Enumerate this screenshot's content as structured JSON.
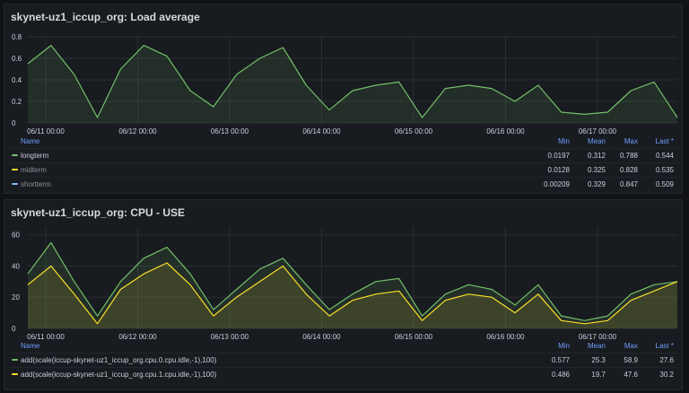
{
  "panels": [
    {
      "title": "skynet-uz1_iccup_org: Load average",
      "y_ticks": [
        "0.8",
        "0.6",
        "0.4",
        "0.2",
        "0"
      ],
      "x_ticks": [
        "06/11 00:00",
        "06/12 00:00",
        "06/13 00:00",
        "06/14 00:00",
        "06/15 00:00",
        "06/16 00:00",
        "06/17 00:00"
      ],
      "legend_headers": {
        "name": "Name",
        "min": "Min",
        "mean": "Mean",
        "max": "Max",
        "last": "Last *"
      },
      "legend": [
        {
          "name": "longterm",
          "color": "#73bf69",
          "min": "0.0197",
          "mean": "0.312",
          "max": "0.788",
          "last": "0.544"
        },
        {
          "name": "midterm",
          "color": "#fade2a",
          "min": "0.0128",
          "mean": "0.325",
          "max": "0.828",
          "last": "0.535"
        },
        {
          "name": "shortterm",
          "color": "#8ab8ff",
          "min": "0.00209",
          "mean": "0.329",
          "max": "0.847",
          "last": "0.509"
        }
      ]
    },
    {
      "title": "skynet-uz1_iccup_org: CPU - USE",
      "y_ticks": [
        "60",
        "40",
        "20",
        "0"
      ],
      "x_ticks": [
        "06/11 00:00",
        "06/12 00:00",
        "06/13 00:00",
        "06/14 00:00",
        "06/15 00:00",
        "06/16 00:00",
        "06/17 00:00"
      ],
      "legend_headers": {
        "name": "Name",
        "min": "Min",
        "mean": "Mean",
        "max": "Max",
        "last": "Last *"
      },
      "legend": [
        {
          "name": "add(scale(iccup-skynet-uz1_iccup_org.cpu.0.cpu.idle,-1),100)",
          "color": "#73bf69",
          "min": "0.577",
          "mean": "25.3",
          "max": "58.9",
          "last": "27.6"
        },
        {
          "name": "add(scale(iccup-skynet-uz1_iccup_org.cpu.1.cpu.idle,-1),100)",
          "color": "#fade2a",
          "min": "0.486",
          "mean": "19.7",
          "max": "47.6",
          "last": "30.2"
        }
      ]
    }
  ],
  "chart_data": [
    {
      "type": "area",
      "title": "skynet-uz1_iccup_org: Load average",
      "x": [
        "06/10 18:00",
        "06/11 00:00",
        "06/11 06:00",
        "06/11 12:00",
        "06/11 18:00",
        "06/12 00:00",
        "06/12 06:00",
        "06/12 12:00",
        "06/12 18:00",
        "06/13 00:00",
        "06/13 06:00",
        "06/13 12:00",
        "06/13 18:00",
        "06/14 00:00",
        "06/14 06:00",
        "06/14 12:00",
        "06/14 18:00",
        "06/15 00:00",
        "06/15 06:00",
        "06/15 12:00",
        "06/15 18:00",
        "06/16 00:00",
        "06/16 06:00",
        "06/16 12:00",
        "06/16 18:00",
        "06/17 00:00",
        "06/17 06:00",
        "06/17 12:00",
        "06/17 18:00"
      ],
      "series": [
        {
          "name": "longterm",
          "values": [
            0.55,
            0.72,
            0.45,
            0.05,
            0.5,
            0.72,
            0.62,
            0.3,
            0.15,
            0.45,
            0.6,
            0.7,
            0.35,
            0.12,
            0.3,
            0.35,
            0.38,
            0.05,
            0.32,
            0.35,
            0.32,
            0.2,
            0.35,
            0.1,
            0.08,
            0.1,
            0.3,
            0.38,
            0.05
          ]
        }
      ],
      "ylim": [
        0,
        0.8
      ],
      "grid": true,
      "legend": "bottom"
    },
    {
      "type": "area",
      "title": "skynet-uz1_iccup_org: CPU - USE",
      "x": [
        "06/10 18:00",
        "06/11 00:00",
        "06/11 06:00",
        "06/11 12:00",
        "06/11 18:00",
        "06/12 00:00",
        "06/12 06:00",
        "06/12 12:00",
        "06/12 18:00",
        "06/13 00:00",
        "06/13 06:00",
        "06/13 12:00",
        "06/13 18:00",
        "06/14 00:00",
        "06/14 06:00",
        "06/14 12:00",
        "06/14 18:00",
        "06/15 00:00",
        "06/15 06:00",
        "06/15 12:00",
        "06/15 18:00",
        "06/16 00:00",
        "06/16 06:00",
        "06/16 12:00",
        "06/16 18:00",
        "06/17 00:00",
        "06/17 06:00",
        "06/17 12:00",
        "06/17 18:00"
      ],
      "series": [
        {
          "name": "add(scale(iccup-skynet-uz1_iccup_org.cpu.0.cpu.idle,-1),100)",
          "values": [
            35,
            55,
            30,
            8,
            30,
            45,
            52,
            35,
            12,
            25,
            38,
            45,
            28,
            12,
            22,
            30,
            32,
            8,
            22,
            28,
            25,
            15,
            28,
            8,
            5,
            8,
            22,
            28,
            30
          ]
        },
        {
          "name": "add(scale(iccup-skynet-uz1_iccup_org.cpu.1.cpu.idle,-1),100)",
          "values": [
            28,
            40,
            22,
            3,
            25,
            35,
            42,
            28,
            8,
            20,
            30,
            40,
            22,
            8,
            18,
            22,
            24,
            5,
            18,
            22,
            20,
            10,
            22,
            5,
            3,
            5,
            18,
            24,
            30
          ]
        }
      ],
      "ylim": [
        0,
        65
      ],
      "grid": true,
      "legend": "bottom"
    }
  ]
}
